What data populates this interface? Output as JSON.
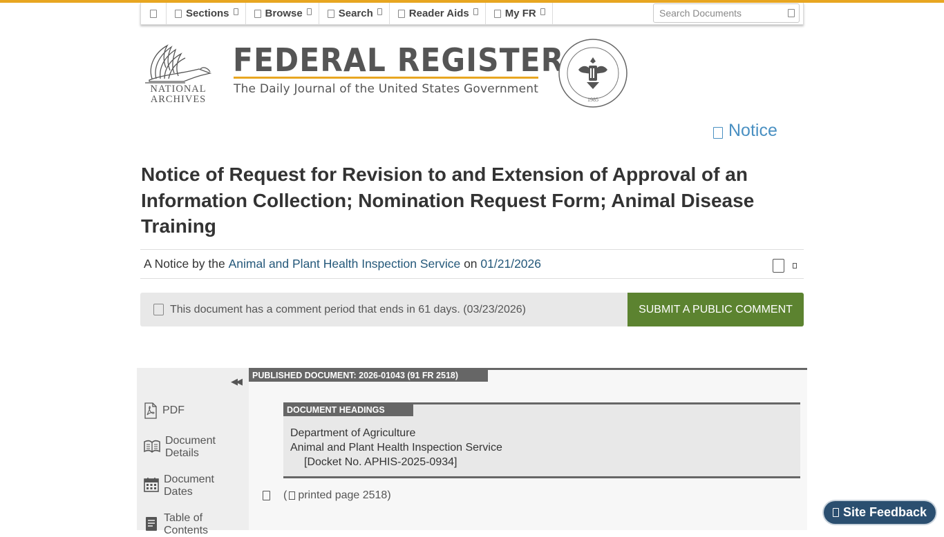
{
  "nav": {
    "items": [
      {
        "label": "Sections"
      },
      {
        "label": "Browse"
      },
      {
        "label": "Search"
      },
      {
        "label": "Reader Aids"
      },
      {
        "label": "My FR"
      }
    ],
    "search_placeholder": "Search Documents"
  },
  "masthead": {
    "archives_line1": "NATIONAL",
    "archives_line2": "ARCHIVES",
    "title": "FEDERAL REGISTER",
    "subtitle": "The Daily Journal of the United States Government",
    "seal_year": "1985"
  },
  "document": {
    "type": "Notice",
    "title": "Notice of Request for Revision to and Extension of Approval of an Information Collection; Nomination Request Form; Animal Disease Training",
    "byline_prefix": "A Notice by the",
    "agency": "Animal and Plant Health Inspection Service",
    "byline_on": "on",
    "date": "01/21/2026",
    "comment_notice": "This document has a comment period that ends in 61 days. (03/23/2026)",
    "submit_label": "SUBMIT A PUBLIC COMMENT"
  },
  "sidebar": {
    "items": [
      {
        "label": "PDF",
        "icon": "pdf-icon"
      },
      {
        "label": "Document Details",
        "icon": "book-icon"
      },
      {
        "label": "Document Dates",
        "icon": "calendar-icon"
      },
      {
        "label": "Table of Contents",
        "icon": "contents-icon"
      }
    ]
  },
  "content": {
    "published_label": "PUBLISHED DOCUMENT: 2026-01043 (91 FR 2518)",
    "headings_label": "DOCUMENT HEADINGS",
    "department": "Department of Agriculture",
    "agency": "Animal and Plant Health Inspection Service",
    "docket": "[Docket No. APHIS-2025-0934]",
    "printed_prefix": "(",
    "printed_page": "printed page 2518)"
  },
  "feedback": {
    "label": "Site Feedback"
  },
  "colors": {
    "accent": "#e8a621",
    "link": "#24587a",
    "submit": "#5c8330",
    "feedback": "#2b4f70"
  }
}
